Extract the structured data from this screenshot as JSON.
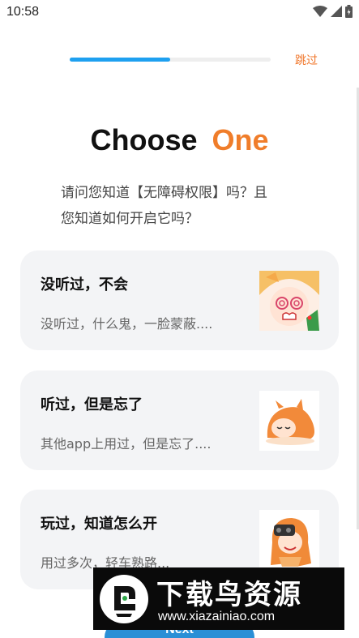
{
  "status_bar": {
    "time": "10:58",
    "icons": [
      "wifi-icon",
      "signal-icon",
      "battery-icon"
    ]
  },
  "progress": {
    "fraction": 0.5,
    "color": "#1ea0f0",
    "track_color": "#eeeeee"
  },
  "skip_label": "跳过",
  "heading": {
    "word1": "Choose",
    "word2": "One",
    "accent_color": "#f07d2a"
  },
  "question": {
    "line1": "请问您知道【无障碍权限】吗？且",
    "line2": "您知道如何开启它吗？"
  },
  "options": [
    {
      "title": "没听过，不会",
      "subtitle": "没听过，什么鬼，一脸蒙蔽....",
      "image": "shocked-anime-girl-icon"
    },
    {
      "title": "听过，但是忘了",
      "subtitle": "其他app上用过，但是忘了....",
      "image": "sleeping-anime-girl-icon"
    },
    {
      "title": "玩过，知道怎么开",
      "subtitle": "用过多次，轻车熟路...",
      "image": "gaming-anime-girl-icon"
    }
  ],
  "next_button": {
    "label": "Next",
    "color": "#2a8fd6"
  },
  "watermark": {
    "title": "下载鸟资源",
    "url": "www.xiazainiao.com"
  }
}
